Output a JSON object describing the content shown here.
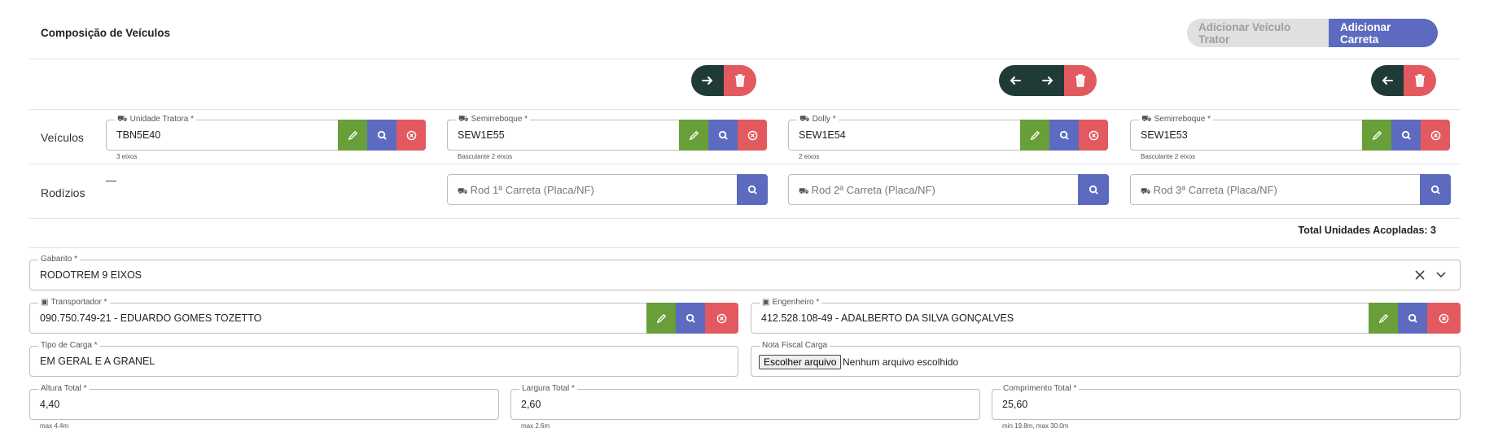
{
  "header": {
    "title": "Composição de Veículos",
    "add_tractor_label": "Adicionar Veículo Trator",
    "add_trailer_label": "Adicionar Carreta"
  },
  "rows": {
    "vehicles_label": "Veículos",
    "rodizios_label": "Rodízios",
    "rodizio_first": "—"
  },
  "vehicles": [
    {
      "label": "Unidade Tratora *",
      "value": "TBN5E40",
      "hint": "3 eixos",
      "icon": "truck-icon"
    },
    {
      "label": "Semirreboque *",
      "value": "SEW1E55",
      "hint": "Basculante 2 eixos",
      "icon": "trailer-icon"
    },
    {
      "label": "Dolly *",
      "value": "SEW1E54",
      "hint": "2 eixos",
      "icon": "trailer-icon"
    },
    {
      "label": "Semirreboque *",
      "value": "SEW1E53",
      "hint": "Basculante 2 eixos",
      "icon": "trailer-icon"
    }
  ],
  "rodizios": [
    {
      "placeholder": "Rod 1ª Carreta (Placa/NF)"
    },
    {
      "placeholder": "Rod 2ª Carreta (Placa/NF)"
    },
    {
      "placeholder": "Rod 3ª Carreta (Placa/NF)"
    }
  ],
  "total_label": "Total Unidades Acopladas: 3",
  "gabarito": {
    "label": "Gabarito *",
    "value": "RODOTREM 9 EIXOS"
  },
  "transportador": {
    "label": "Transportador *",
    "value": "090.750.749-21 - EDUARDO GOMES TOZETTO"
  },
  "engenheiro": {
    "label": "Engenheiro *",
    "value": "412.528.108-49 - ADALBERTO DA SILVA GONÇALVES"
  },
  "tipo_carga": {
    "label": "Tipo de Carga *",
    "value": "EM GERAL E A GRANEL"
  },
  "nota_fiscal": {
    "label": "Nota Fiscal Carga",
    "button": "Escolher arquivo",
    "status": "Nenhum arquivo escolhido"
  },
  "altura": {
    "label": "Altura Total *",
    "value": "4,40",
    "hint": "max 4.4m"
  },
  "largura": {
    "label": "Largura Total *",
    "value": "2,60",
    "hint": "max 2.6m"
  },
  "comprimento": {
    "label": "Comprimento Total *",
    "value": "25,60",
    "hint": "min 19.8m, max 30.0m"
  },
  "colors": {
    "green": "#689f38",
    "blue": "#5c6bc0",
    "red": "#e25a5f",
    "dark": "#1f3a37"
  }
}
